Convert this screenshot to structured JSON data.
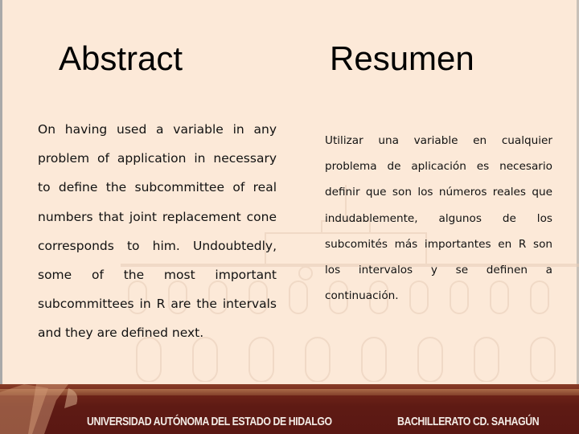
{
  "slide": {
    "left_title": "Abstract",
    "right_title": "Resumen",
    "left_text": "On having used a variable in any problem of application in necessary to define the subcommittee of real numbers that joint replacement cone corresponds to him. Undoubtedly, some of the most important subcommittees in R are the intervals and they are defined next.",
    "right_text": "Utilizar una variable en cualquier problema de aplicación es necesario definir que son los números reales que indudablemente, algunos de los subcomités más importantes en R son los intervalos y se definen a continuación."
  },
  "footer": {
    "institution": "UNIVERSIDAD AUTÓNOMA DEL ESTADO DE HIDALGO",
    "campus": "BACHILLERATO CD. SAHAGÚN"
  }
}
